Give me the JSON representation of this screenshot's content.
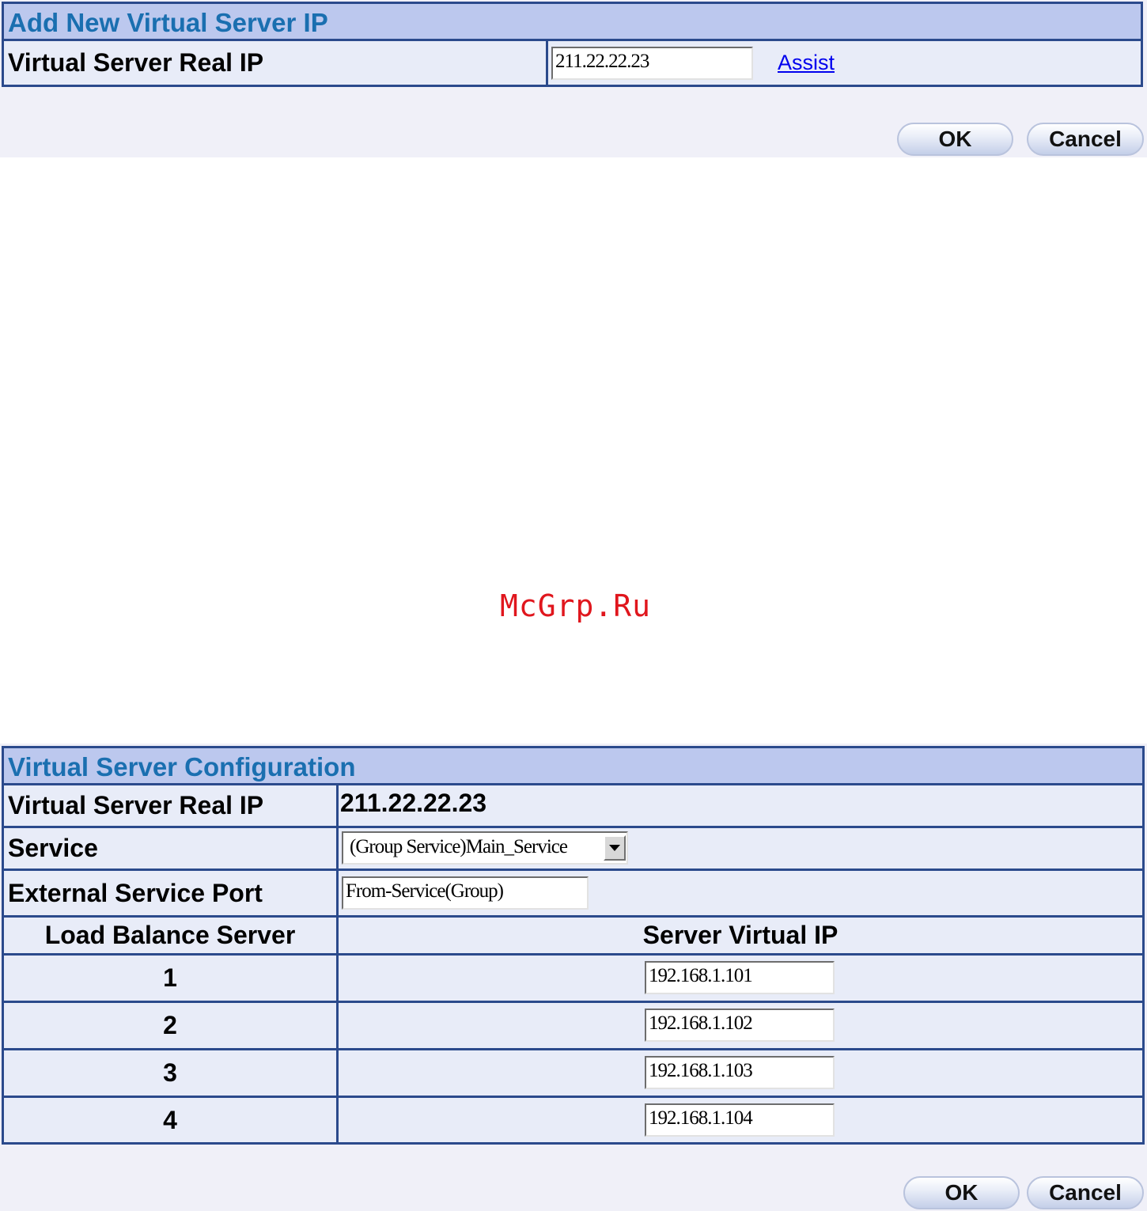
{
  "add_panel": {
    "title": "Add New Virtual Server IP",
    "real_ip_label": "Virtual Server Real IP",
    "real_ip_value": "211.22.22.23",
    "assist_link": "Assist",
    "ok_label": "OK",
    "cancel_label": "Cancel"
  },
  "watermark": "McGrp.Ru",
  "config_panel": {
    "title": "Virtual Server Configuration",
    "real_ip_label": "Virtual Server Real IP",
    "real_ip_value": "211.22.22.23",
    "service_label": "Service",
    "service_value": "(Group Service)Main_Service",
    "ext_port_label": "External Service Port",
    "ext_port_value": "From-Service(Group)",
    "columns": [
      "Load Balance Server",
      "Server Virtual IP"
    ],
    "servers": [
      {
        "index": "1",
        "ip": "192.168.1.101"
      },
      {
        "index": "2",
        "ip": "192.168.1.102"
      },
      {
        "index": "3",
        "ip": "192.168.1.103"
      },
      {
        "index": "4",
        "ip": "192.168.1.104"
      }
    ],
    "ok_label": "OK",
    "cancel_label": "Cancel"
  }
}
